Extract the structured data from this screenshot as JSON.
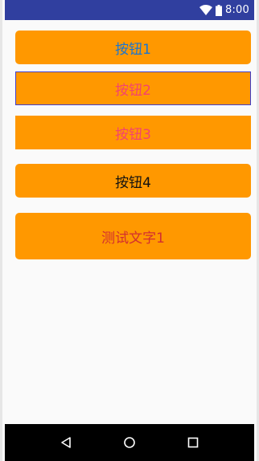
{
  "status_bar": {
    "time": "8:00",
    "icons": [
      "wifi-icon",
      "battery-icon"
    ]
  },
  "buttons": [
    {
      "label": "按钮1",
      "text_color": "#1976d2"
    },
    {
      "label": "按钮2",
      "text_color": "#f4436f"
    },
    {
      "label": "按钮3",
      "text_color": "#f4436f"
    },
    {
      "label": "按钮4",
      "text_color": "#111111"
    }
  ],
  "test_text": {
    "label": "测试文字1",
    "text_color": "#d32f2f"
  },
  "colors": {
    "accent": "#ff9800",
    "status_bar": "#303f9f",
    "nav_bar": "#000000",
    "background": "#fafafa"
  },
  "nav_bar": {
    "icons": [
      "back-icon",
      "home-icon",
      "recents-icon"
    ]
  }
}
